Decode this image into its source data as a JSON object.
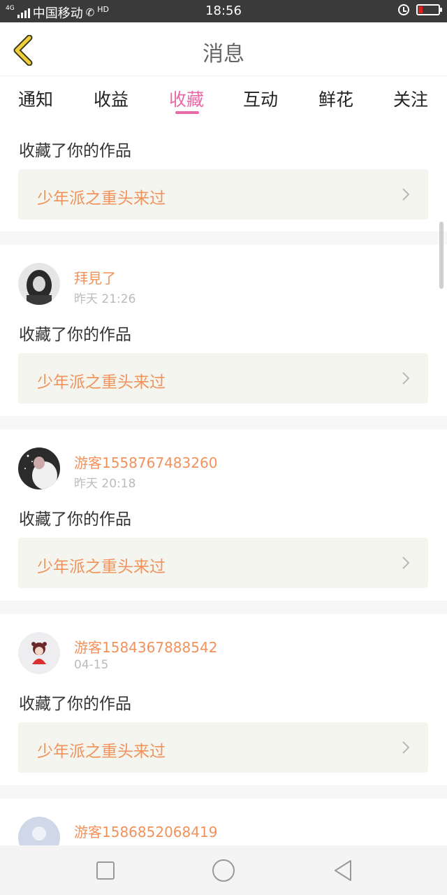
{
  "status_bar": {
    "network": "4G",
    "carrier": "中国移动",
    "call_badge": "HD",
    "time": "18:56"
  },
  "header": {
    "title": "消息"
  },
  "tabs": [
    {
      "label": "通知",
      "active": false
    },
    {
      "label": "收益",
      "active": false
    },
    {
      "label": "收藏",
      "active": true
    },
    {
      "label": "互动",
      "active": false
    },
    {
      "label": "鲜花",
      "active": false
    },
    {
      "label": "关注",
      "active": false
    }
  ],
  "items": [
    {
      "user": "",
      "time": "",
      "action": "收藏了你的作品",
      "work": "少年派之重头来过"
    },
    {
      "user": "拜見了",
      "time": "昨天 21:26",
      "action": "收藏了你的作品",
      "work": "少年派之重头来过"
    },
    {
      "user": "游客1558767483260",
      "time": "昨天 20:18",
      "action": "收藏了你的作品",
      "work": "少年派之重头来过"
    },
    {
      "user": "游客1584367888542",
      "time": "04-15",
      "action": "收藏了你的作品",
      "work": "少年派之重头来过"
    },
    {
      "user": "游客1586852068419",
      "time": "",
      "action": "",
      "work": ""
    }
  ],
  "colors": {
    "accent_pink": "#e86aa6",
    "username_orange": "#f0925c",
    "work_bg": "#f5f5ef",
    "back_arrow": "#f2d03b"
  },
  "icons": {
    "back": "chevron-left-icon",
    "row_arrow": "chevron-right-icon",
    "nav_recent": "square-icon",
    "nav_home": "circle-icon",
    "nav_back": "triangle-back-icon"
  }
}
